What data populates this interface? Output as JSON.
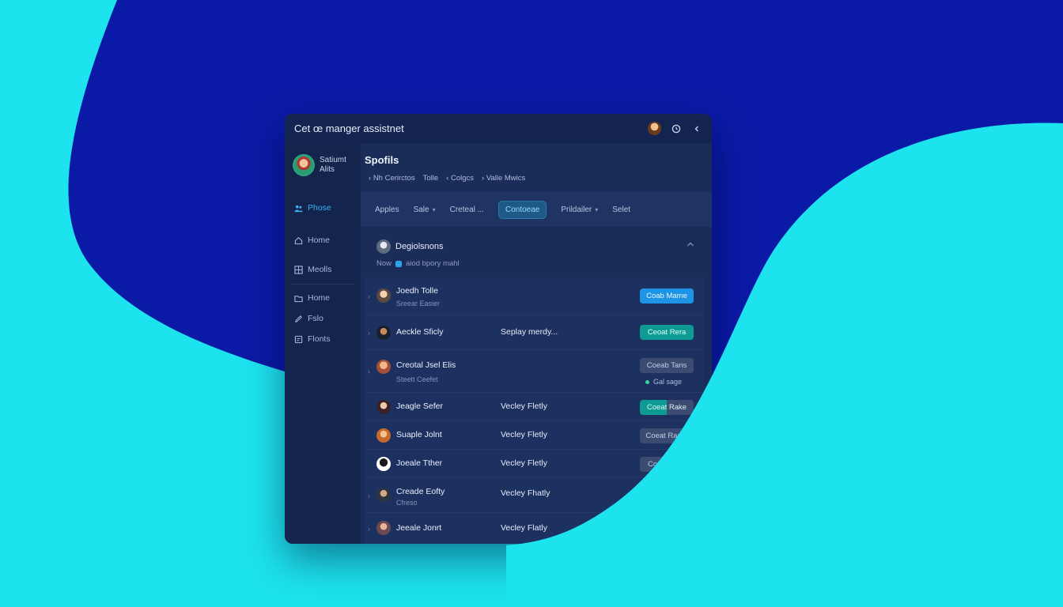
{
  "colors": {
    "background_cyan": "#1de3ef",
    "background_navy": "#0a1aa6",
    "window": "#172a55",
    "accent_blue": "#1d94e6",
    "accent_teal": "#0d9b93"
  },
  "window": {
    "title": "Cet œ manger assistnet",
    "icons": [
      "avatar",
      "clock-icon",
      "chevron-left-icon"
    ]
  },
  "sidebar": {
    "profile": {
      "line1": "Satiumt",
      "line2": "Alits"
    },
    "items": [
      {
        "label": "Phose",
        "icon": "people-icon",
        "active": true
      },
      {
        "label": "Home",
        "icon": "home-icon",
        "active": false
      },
      {
        "label": "Meolls",
        "icon": "grid-icon",
        "active": false
      },
      {
        "label": "Home",
        "icon": "folder-icon",
        "active": false
      },
      {
        "label": "Fslo",
        "icon": "pen-icon",
        "active": false
      },
      {
        "label": "Flonts",
        "icon": "file-icon",
        "active": false
      }
    ]
  },
  "main": {
    "title": "Spofils",
    "breadcrumbs": [
      {
        "prefix": "‹",
        "label": "Nh Cerirctos"
      },
      {
        "prefix": "",
        "label": "Tolle"
      },
      {
        "prefix": "‹",
        "label": "Colgcs"
      },
      {
        "prefix": "›",
        "label": "Valle Mwics"
      }
    ],
    "filters": [
      {
        "label": "Apples",
        "dropdown": false,
        "selected": false
      },
      {
        "label": "Sale",
        "dropdown": true,
        "selected": false
      },
      {
        "label": "Creteal ...",
        "dropdown": false,
        "selected": false
      },
      {
        "label": "Contoeae",
        "dropdown": false,
        "selected": true
      },
      {
        "label": "Prildailer",
        "dropdown": true,
        "selected": false
      },
      {
        "label": "Selet",
        "dropdown": false,
        "selected": false
      }
    ],
    "section": {
      "title": "Degiolsnons",
      "subtitle_prefix": "Now",
      "subtitle": "aiod bpory mahl"
    },
    "rows": [
      {
        "name": "Joedh Tolle",
        "sub": "Sreear Easier",
        "mid": "",
        "button": "Coab Mame",
        "button_style": "blue",
        "status": ""
      },
      {
        "name": "Aeckle Sficly",
        "sub": "",
        "mid": "Seplay merdy...",
        "button": "Ceoat Rera",
        "button_style": "teal",
        "status": ""
      },
      {
        "name": "Creotal Jsel Elis",
        "sub": "Steett Ceefet",
        "mid": "",
        "button": "Coeab Tans",
        "button_style": "gray",
        "status": "Gal sage"
      },
      {
        "name": "Jeagle Sefer",
        "sub": "",
        "mid": "Vecley Fletly",
        "button": "Coeat Rake",
        "button_style": "split",
        "status": ""
      },
      {
        "name": "Suaple Jolnt",
        "sub": "",
        "mid": "Vecley Fletly",
        "button": "Coeat Rame",
        "button_style": "gray",
        "status": ""
      },
      {
        "name": "Joeale Tther",
        "sub": "",
        "mid": "Vecley Fletly",
        "button": "Coeat Rem",
        "button_style": "gray",
        "status": ""
      },
      {
        "name": "Creade Eofty",
        "sub": "Cfreso",
        "mid": "Vecley Fhatly",
        "button": "",
        "button_style": "gray",
        "status": ""
      },
      {
        "name": "Jeeale Jonrt",
        "sub": "",
        "mid": "Vecley Flatly",
        "button": "",
        "button_style": "gray",
        "status": ""
      }
    ]
  }
}
